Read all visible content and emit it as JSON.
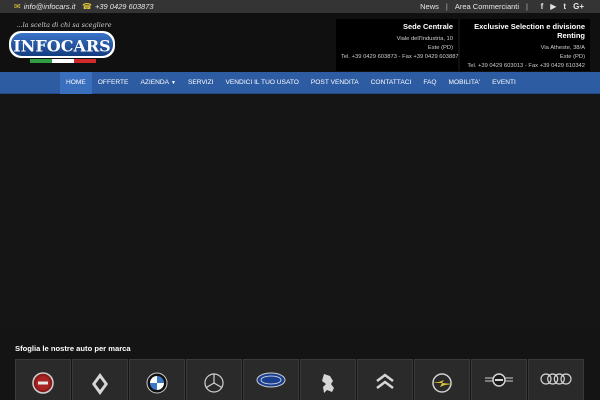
{
  "topbar": {
    "email": "info@infocars.it",
    "phone": "+39 0429 603873",
    "links": [
      "News",
      "Area Commercianti"
    ],
    "social": [
      {
        "icon": "facebook-icon",
        "glyph": "f"
      },
      {
        "icon": "youtube-icon",
        "glyph": "▶"
      },
      {
        "icon": "twitter-icon",
        "glyph": "t"
      },
      {
        "icon": "google-plus-icon",
        "glyph": "G+"
      }
    ]
  },
  "logo": {
    "tagline": "...la scelta di chi sa scegliere",
    "text": "INFOCARS"
  },
  "offices": [
    {
      "name": "Sede Centrale",
      "address": "Viale dell'Industria, 10",
      "city": "Este (PD)",
      "contacts": "Tel. +39 0429 603873 - Fax +39 0429 603887"
    },
    {
      "name": "Exclusive Selection e divisione Renting",
      "address": "Via Atheste, 38/A",
      "city": "Este (PD)",
      "contacts": "Tel. +39 0429 603013 - Fax +39 0429 610342"
    }
  ],
  "nav": {
    "items": [
      {
        "label": "HOME",
        "active": true,
        "dropdown": false
      },
      {
        "label": "OFFERTE",
        "active": false,
        "dropdown": false
      },
      {
        "label": "AZIENDA",
        "active": false,
        "dropdown": true
      },
      {
        "label": "SERVIZI",
        "active": false,
        "dropdown": false
      },
      {
        "label": "VENDICI IL TUO USATO",
        "active": false,
        "dropdown": false
      },
      {
        "label": "POST VENDITA",
        "active": false,
        "dropdown": false
      },
      {
        "label": "CONTATTACI",
        "active": false,
        "dropdown": false
      },
      {
        "label": "FAQ",
        "active": false,
        "dropdown": false
      },
      {
        "label": "MOBILITA'",
        "active": false,
        "dropdown": false
      },
      {
        "label": "EVENTI",
        "active": false,
        "dropdown": false
      }
    ]
  },
  "brands": {
    "title": "Sfoglia le nostre auto per marca",
    "items": [
      "fiat",
      "renault",
      "bmw",
      "mercedes",
      "ford",
      "peugeot",
      "citroen",
      "opel",
      "mini",
      "audi"
    ]
  },
  "colors": {
    "nav_blue": "#2e5ca3",
    "accent_yellow": "#d8c23c",
    "logo_blue": "#1d4fa0"
  }
}
